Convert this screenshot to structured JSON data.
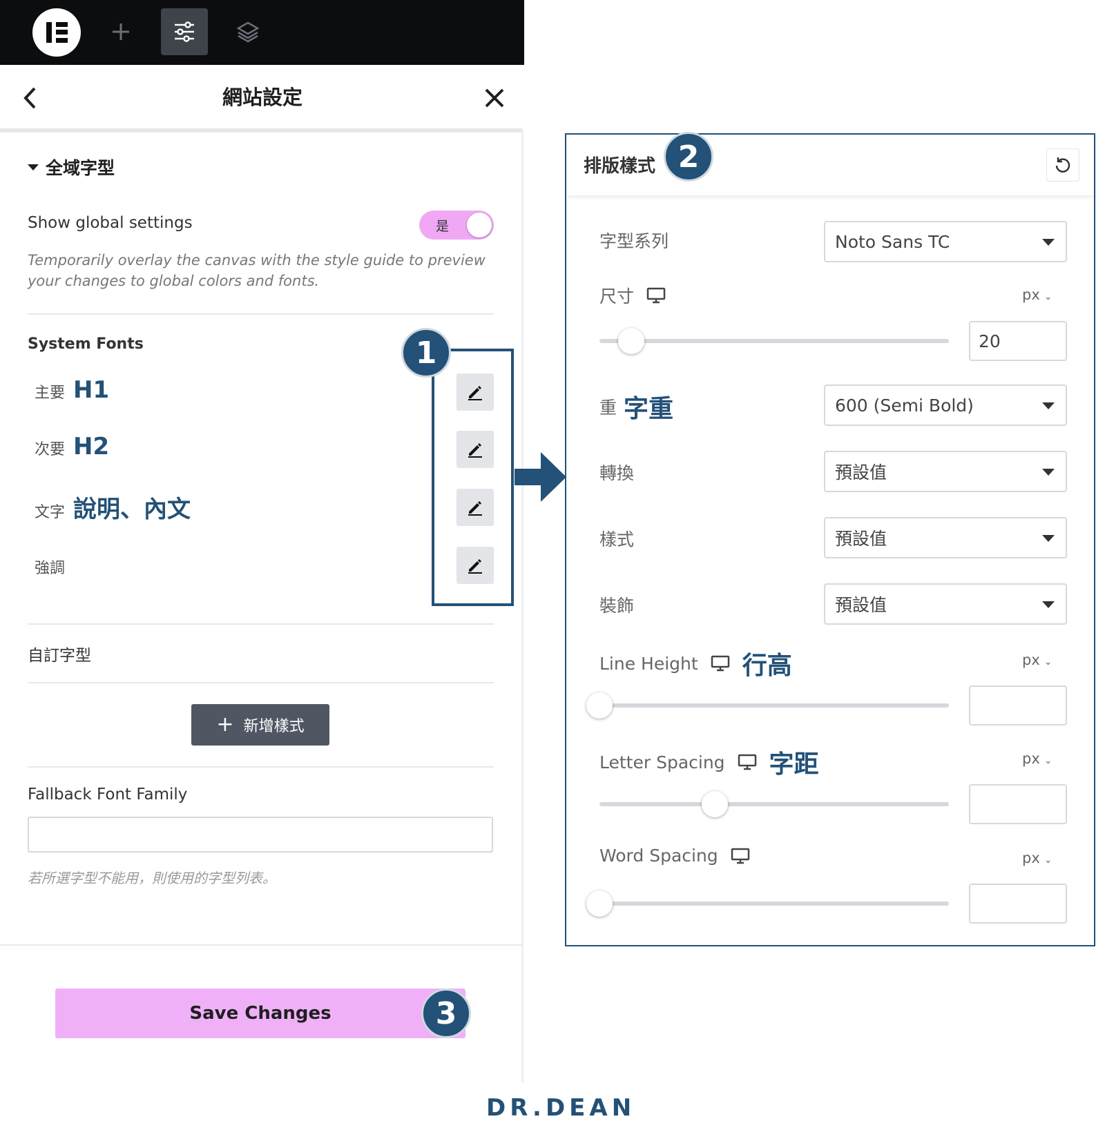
{
  "panel": {
    "title": "網站設定",
    "section_title": "全域字型",
    "show_global": {
      "label": "Show global settings",
      "toggle_label": "是",
      "toggle_on": true,
      "description": "Temporarily overlay the canvas with the style guide to preview your changes to global colors and fonts."
    },
    "system_fonts_label": "System Fonts",
    "system_fonts": [
      {
        "small": "主要",
        "big": "H1"
      },
      {
        "small": "次要",
        "big": "H2"
      },
      {
        "small": "文字",
        "big": "說明、內文"
      },
      {
        "small": "強調",
        "big": ""
      }
    ],
    "custom_fonts_label": "自訂字型",
    "add_style_label": "新增樣式",
    "fallback_label": "Fallback Font Family",
    "fallback_value": "",
    "fallback_hint": "若所選字型不能用，則使用的字型列表。",
    "save_label": "Save Changes"
  },
  "badges": {
    "one": "1",
    "two": "2",
    "three": "3"
  },
  "typography": {
    "title": "排版樣式",
    "font_family": {
      "label": "字型系列",
      "value": "Noto Sans TC"
    },
    "size": {
      "label": "尺寸",
      "unit": "px",
      "value": "20",
      "slider": 0.09
    },
    "weight": {
      "label": "重",
      "highlight": "字重",
      "value": "600 (Semi Bold)"
    },
    "transform": {
      "label": "轉換",
      "value": "預設值"
    },
    "style": {
      "label": "樣式",
      "value": "預設值"
    },
    "decoration": {
      "label": "裝飾",
      "value": "預設值"
    },
    "line_height": {
      "label": "Line Height",
      "highlight": "行高",
      "unit": "px",
      "value": "",
      "slider": 0.0
    },
    "letter_spacing": {
      "label": "Letter Spacing",
      "highlight": "字距",
      "unit": "px",
      "value": "",
      "slider": 0.33
    },
    "word_spacing": {
      "label": "Word Spacing",
      "unit": "px",
      "value": "",
      "slider": 0.0
    }
  },
  "brand": {
    "text": "DR.DEAN"
  },
  "colors": {
    "accent": "#235177",
    "toggle": "#f0a8f5",
    "save": "#f0b0f8",
    "topbar": "#0c0d0e"
  }
}
